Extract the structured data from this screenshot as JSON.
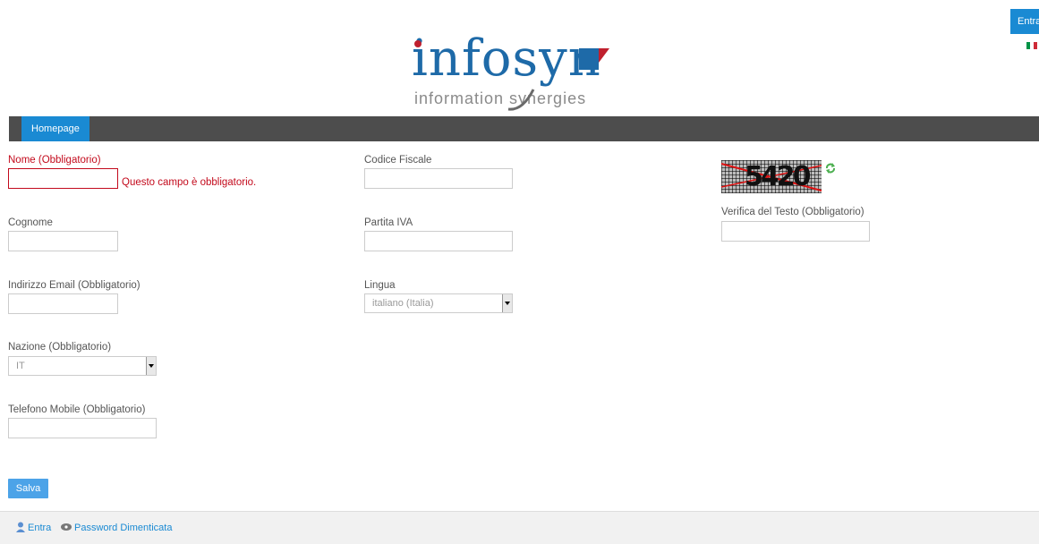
{
  "header": {
    "login_button": "Entra",
    "flag": "italian-flag",
    "logo": {
      "word": "infosyn",
      "tagline": "information synergies",
      "brand_color": "#1e6aa8",
      "accent_color": "#c0202e"
    }
  },
  "nav": {
    "tabs": [
      {
        "label": "Homepage",
        "active": true
      }
    ]
  },
  "form": {
    "nome": {
      "label": "Nome (Obbligatorio)",
      "value": "",
      "error": "Questo campo è obbligatorio."
    },
    "cognome": {
      "label": "Cognome",
      "value": ""
    },
    "email": {
      "label": "Indirizzo Email (Obbligatorio)",
      "value": ""
    },
    "nazione": {
      "label": "Nazione (Obbligatorio)",
      "value": "IT"
    },
    "telefono": {
      "label": "Telefono Mobile (Obbligatorio)",
      "value": ""
    },
    "codice_fiscale": {
      "label": "Codice Fiscale",
      "value": ""
    },
    "partita_iva": {
      "label": "Partita IVA",
      "value": ""
    },
    "lingua": {
      "label": "Lingua",
      "value": "italiano (Italia)"
    },
    "captcha": {
      "text": "5420",
      "refresh_icon": "refresh-icon"
    },
    "verifica": {
      "label": "Verifica del Testo (Obbligatorio)",
      "value": ""
    },
    "save_label": "Salva"
  },
  "footer": {
    "login": {
      "label": "Entra",
      "icon": "user-icon"
    },
    "forgot": {
      "label": "Password Dimenticata",
      "icon": "key-icon"
    }
  },
  "colors": {
    "accent": "#1a8ad3",
    "error": "#c30a1c",
    "navbar": "#4d4d4d"
  }
}
